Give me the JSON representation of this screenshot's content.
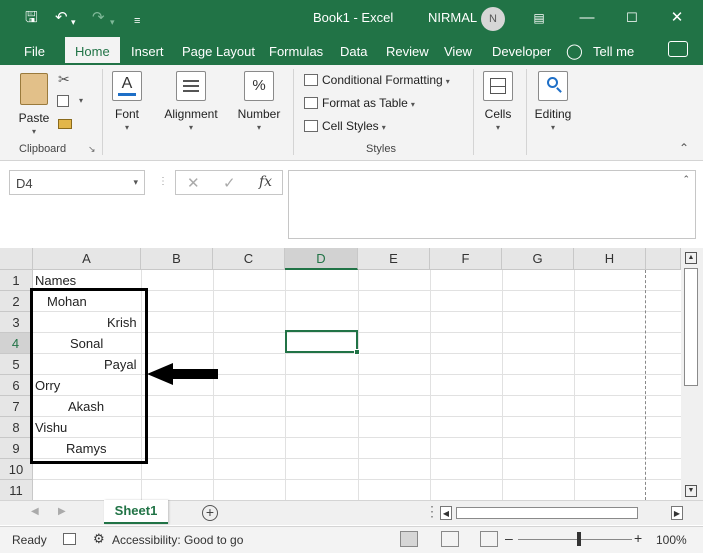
{
  "titlebar": {
    "doc_title": "Book1  -  Excel",
    "user_name": "NIRMAL",
    "avatar_initial": "N",
    "qa_icons": [
      "save-icon",
      "undo-icon",
      "redo-icon",
      "customize-icon"
    ],
    "window_buttons": [
      "ribbon-display-icon",
      "minimize-icon",
      "maximize-icon",
      "close-icon"
    ]
  },
  "tabs": {
    "items": [
      "File",
      "Home",
      "Insert",
      "Page Layout",
      "Formulas",
      "Data",
      "Review",
      "View",
      "Developer",
      "Tell me"
    ],
    "active": "Home"
  },
  "ribbon": {
    "clipboard": {
      "paste": "Paste",
      "label": "Clipboard"
    },
    "font": {
      "label": "Font"
    },
    "alignment": {
      "label": "Alignment"
    },
    "number": {
      "label": "Number"
    },
    "styles": {
      "conditional_formatting": "Conditional Formatting",
      "format_as_table": "Format as Table",
      "cell_styles": "Cell Styles",
      "label": "Styles"
    },
    "cells": {
      "label": "Cells"
    },
    "editing": {
      "label": "Editing"
    }
  },
  "formula_bar": {
    "name_box": "D4",
    "formula_value": "",
    "fx": "fx"
  },
  "grid": {
    "columns": [
      "A",
      "B",
      "C",
      "D",
      "E",
      "F",
      "G",
      "H"
    ],
    "rows": [
      "1",
      "2",
      "3",
      "4",
      "5",
      "6",
      "7",
      "8",
      "9",
      "10",
      "11"
    ],
    "selected_column": "D",
    "selected_row": "4",
    "column_a": [
      "Names",
      "Mohan",
      "Krish",
      "Sonal",
      "Payal",
      "Orry",
      "Akash",
      "Vishu",
      "Ramys"
    ]
  },
  "sheets": {
    "tabs": [
      "Sheet1"
    ],
    "active": "Sheet1"
  },
  "status": {
    "ready": "Ready",
    "accessibility": "Accessibility: Good to go",
    "zoom": "100%"
  }
}
